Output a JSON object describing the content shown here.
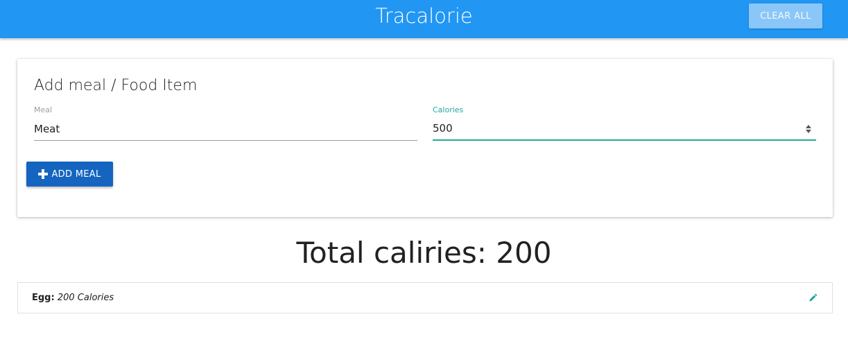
{
  "navbar": {
    "title": "Tracalorie",
    "clear_all_label": "CLEAR ALL",
    "color": "#2196f3"
  },
  "form": {
    "title": "Add meal / Food Item",
    "meal_label": "Meal",
    "meal_value": "Meat",
    "calories_label": "Calories",
    "calories_value": "500",
    "add_button_label": "ADD MEAL",
    "add_icon": "plus-icon"
  },
  "total": {
    "label": "Total caliries:",
    "value": "200"
  },
  "items": [
    {
      "name": "Egg:",
      "calories": "200 Calories",
      "icon": "pencil-icon"
    }
  ],
  "colors": {
    "primary": "#2196f3",
    "accent": "#26a69a",
    "button": "#1565c0"
  }
}
